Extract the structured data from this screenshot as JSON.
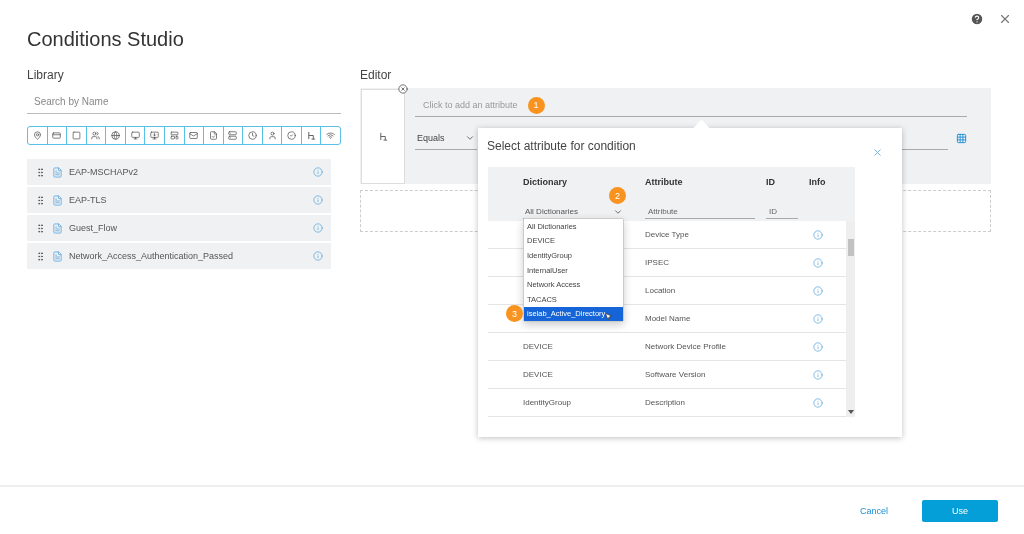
{
  "window": {
    "title": "Conditions Studio"
  },
  "library": {
    "heading": "Library",
    "search": {
      "placeholder": "Search by Name"
    },
    "items": [
      {
        "label": "EAP-MSCHAPv2"
      },
      {
        "label": "EAP-TLS"
      },
      {
        "label": "Guest_Flow"
      },
      {
        "label": "Network_Access_Authentication_Passed"
      }
    ]
  },
  "editor": {
    "heading": "Editor",
    "attribute": {
      "placeholder": "Click to add an attribute",
      "step": "1"
    },
    "operator": {
      "value": "Equals"
    }
  },
  "dialog": {
    "title": "Select attribute for condition",
    "columns": [
      "Dictionary",
      "Attribute",
      "ID",
      "Info"
    ],
    "filters": {
      "dictionary": {
        "value": "All Dictionaries",
        "step": "2"
      },
      "attribute": {
        "placeholder": "Attribute"
      },
      "id": {
        "placeholder": "ID"
      }
    },
    "rows": [
      {
        "attribute": "Device Type"
      },
      {
        "attribute": "IPSEC"
      },
      {
        "attribute": "Location"
      },
      {
        "attribute": "Model Name"
      },
      {
        "dictionary": "DEVICE",
        "attribute": "Network Device Profile"
      },
      {
        "dictionary": "DEVICE",
        "attribute": "Software Version"
      },
      {
        "dictionary": "IdentityGroup",
        "attribute": "Description"
      }
    ],
    "dropdown": {
      "step": "3",
      "options": [
        {
          "label": "All Dictionaries",
          "selected": false
        },
        {
          "label": "DEVICE",
          "selected": false
        },
        {
          "label": "IdentityGroup",
          "selected": false
        },
        {
          "label": "InternalUser",
          "selected": false
        },
        {
          "label": "Network Access",
          "selected": false
        },
        {
          "label": "TACACS",
          "selected": false
        },
        {
          "label": "iselab_Active_Directory",
          "selected": true
        }
      ]
    }
  },
  "footer": {
    "buttons": [
      {
        "label": "Cancel",
        "kind": "link"
      },
      {
        "label": "Use",
        "kind": "primary"
      }
    ]
  }
}
